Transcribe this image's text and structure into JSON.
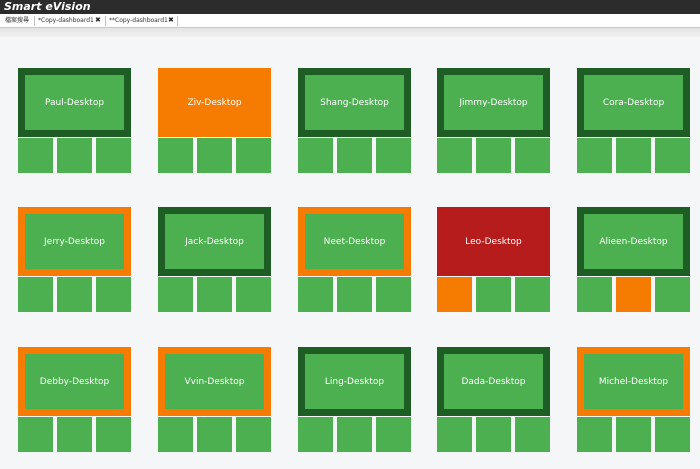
{
  "app": {
    "title": "Smart eVision"
  },
  "tabs": [
    {
      "label": "檔案搜尋",
      "closable": false
    },
    {
      "label": "*Copy-dashboard1",
      "closable": true
    },
    {
      "label": "**Copy-dashboard1",
      "closable": true
    }
  ],
  "close_glyph": "✖",
  "colors": {
    "green": "#4caf50",
    "dark_green": "#1e5e24",
    "orange": "#f57c00",
    "red": "#b71c1c"
  },
  "desktops": [
    {
      "name": "Paul-Desktop",
      "frame": "dark_green",
      "screen": "green",
      "cells": [
        "green",
        "green",
        "green"
      ]
    },
    {
      "name": "Ziv-Desktop",
      "frame": "orange",
      "screen": "orange",
      "cells": [
        "green",
        "green",
        "green"
      ]
    },
    {
      "name": "Shang-Desktop",
      "frame": "dark_green",
      "screen": "green",
      "cells": [
        "green",
        "green",
        "green"
      ]
    },
    {
      "name": "Jimmy-Desktop",
      "frame": "dark_green",
      "screen": "green",
      "cells": [
        "green",
        "green",
        "green"
      ]
    },
    {
      "name": "Cora-Desktop",
      "frame": "dark_green",
      "screen": "green",
      "cells": [
        "green",
        "green",
        "green"
      ]
    },
    {
      "name": "Jerry-Desktop",
      "frame": "orange",
      "screen": "green",
      "cells": [
        "green",
        "green",
        "green"
      ]
    },
    {
      "name": "Jack-Desktop",
      "frame": "dark_green",
      "screen": "green",
      "cells": [
        "green",
        "green",
        "green"
      ]
    },
    {
      "name": "Neet-Desktop",
      "frame": "orange",
      "screen": "green",
      "cells": [
        "green",
        "green",
        "green"
      ]
    },
    {
      "name": "Leo-Desktop",
      "frame": "red",
      "screen": "red",
      "cells": [
        "orange",
        "green",
        "green"
      ]
    },
    {
      "name": "Alieen-Desktop",
      "frame": "dark_green",
      "screen": "green",
      "cells": [
        "green",
        "orange",
        "green"
      ]
    },
    {
      "name": "Debby-Desktop",
      "frame": "orange",
      "screen": "green",
      "cells": [
        "green",
        "green",
        "green"
      ]
    },
    {
      "name": "Vvin-Desktop",
      "frame": "orange",
      "screen": "green",
      "cells": [
        "green",
        "green",
        "green"
      ]
    },
    {
      "name": "Ling-Desktop",
      "frame": "dark_green",
      "screen": "green",
      "cells": [
        "green",
        "green",
        "green"
      ]
    },
    {
      "name": "Dada-Desktop",
      "frame": "dark_green",
      "screen": "green",
      "cells": [
        "green",
        "green",
        "green"
      ]
    },
    {
      "name": "Michel-Desktop",
      "frame": "orange",
      "screen": "green",
      "cells": [
        "green",
        "green",
        "green"
      ]
    }
  ]
}
